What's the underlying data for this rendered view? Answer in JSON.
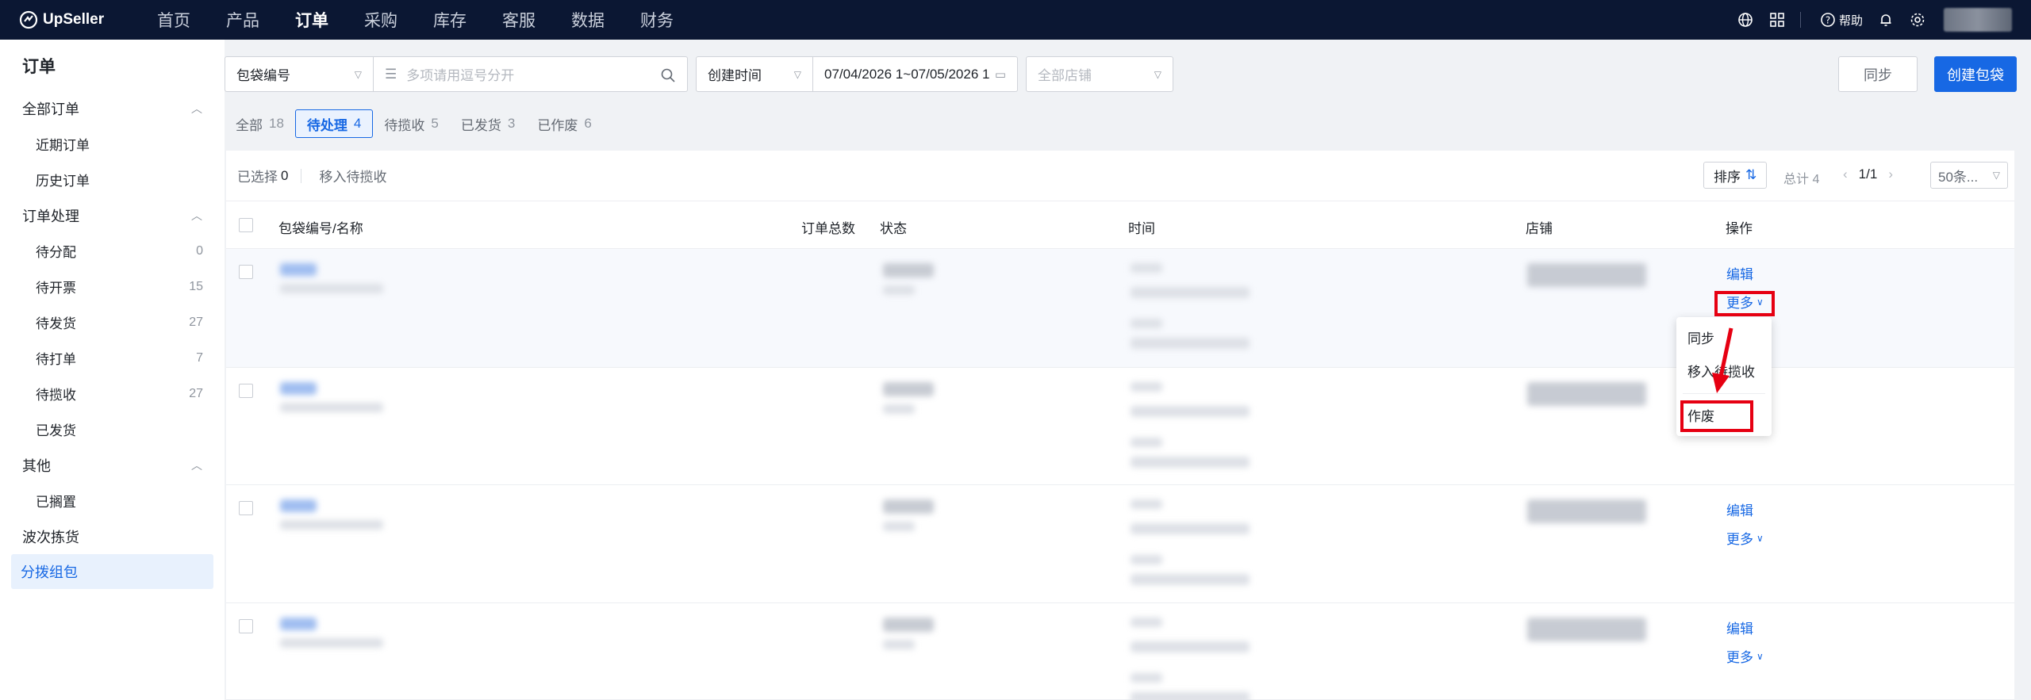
{
  "brand": {
    "name": "UpSeller"
  },
  "nav": {
    "items": [
      "首页",
      "产品",
      "订单",
      "采购",
      "库存",
      "客服",
      "数据",
      "财务"
    ],
    "active_index": 2,
    "help_label": "帮助"
  },
  "sidebar": {
    "title": "订单",
    "groups": [
      {
        "label": "全部订单",
        "items": [
          {
            "label": "近期订单",
            "count": ""
          },
          {
            "label": "历史订单",
            "count": ""
          }
        ]
      },
      {
        "label": "订单处理",
        "items": [
          {
            "label": "待分配",
            "count": "0"
          },
          {
            "label": "待开票",
            "count": "15"
          },
          {
            "label": "待发货",
            "count": "27"
          },
          {
            "label": "待打单",
            "count": "7"
          },
          {
            "label": "待揽收",
            "count": "27"
          },
          {
            "label": "已发货",
            "count": ""
          }
        ]
      },
      {
        "label": "其他",
        "items": [
          {
            "label": "已搁置",
            "count": ""
          }
        ]
      }
    ],
    "plain_items": [
      "波次拣货"
    ],
    "active_item": "分拨组包"
  },
  "filters": {
    "field_select": "包袋编号",
    "search_placeholder": "多项请用逗号分开",
    "time_select": "创建时间",
    "date_range": "07/04/2026 1~07/05/2026 1",
    "shop_placeholder": "全部店铺"
  },
  "buttons": {
    "sync": "同步",
    "create": "创建包袋"
  },
  "tabs": [
    {
      "label": "全部",
      "count": "18"
    },
    {
      "label": "待处理",
      "count": "4"
    },
    {
      "label": "待揽收",
      "count": "5"
    },
    {
      "label": "已发货",
      "count": "3"
    },
    {
      "label": "已作废",
      "count": "6"
    }
  ],
  "toolbar": {
    "selected_label": "已选择",
    "selected_count": "0",
    "move_label": "移入待揽收",
    "sort_label": "排序",
    "total_label": "总计 4",
    "page_label": "1/1",
    "page_size": "50条..."
  },
  "table": {
    "columns": [
      "包袋编号/名称",
      "订单总数",
      "状态",
      "时间",
      "店铺",
      "操作"
    ],
    "edit_label": "编辑",
    "more_label": "更多"
  },
  "dropdown": {
    "items": [
      "同步",
      "移入待揽收",
      "作废"
    ]
  },
  "colors": {
    "accent": "#1768e4",
    "nav_bg": "#0b1733",
    "annotation": "#e60012"
  }
}
